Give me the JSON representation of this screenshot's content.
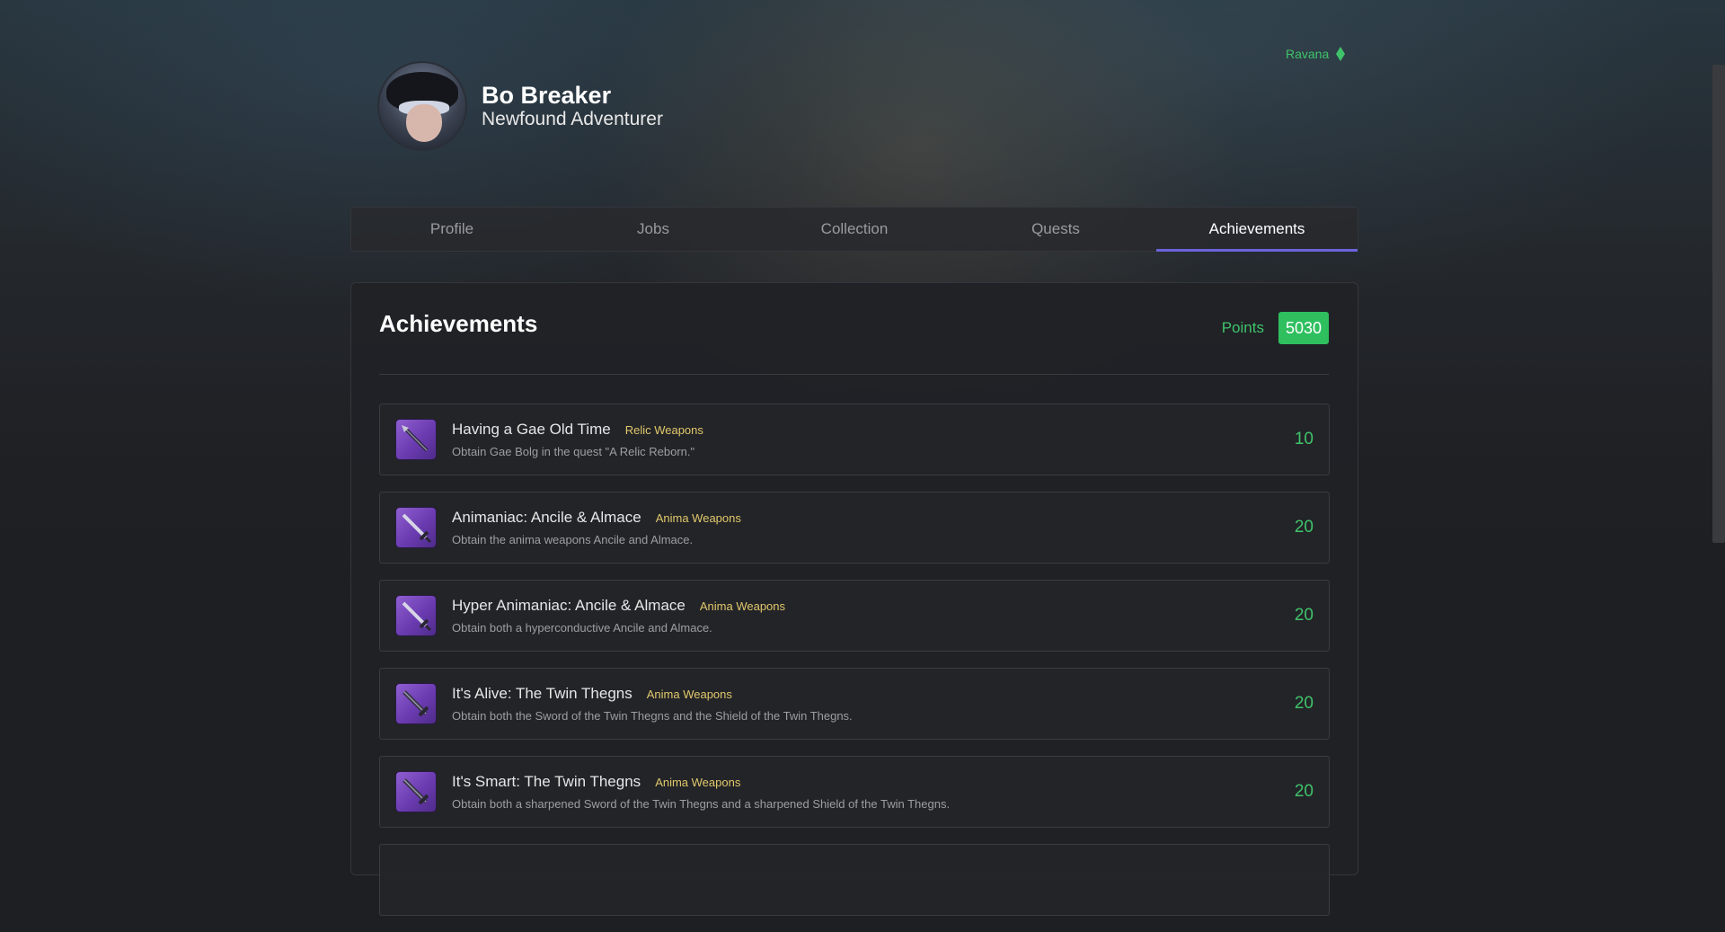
{
  "world": {
    "name": "Ravana",
    "icon": "diamond-icon",
    "color": "#3fc36a"
  },
  "character": {
    "name": "Bo Breaker",
    "title": "Newfound Adventurer"
  },
  "tabs": [
    {
      "label": "Profile",
      "active": false
    },
    {
      "label": "Jobs",
      "active": false
    },
    {
      "label": "Collection",
      "active": false
    },
    {
      "label": "Quests",
      "active": false
    },
    {
      "label": "Achievements",
      "active": true
    }
  ],
  "achievements": {
    "heading": "Achievements",
    "points_label": "Points",
    "points_value": "5030",
    "items": [
      {
        "name": "Having a Gae Old Time",
        "category": "Relic Weapons",
        "description": "Obtain Gae Bolg in the quest \"A Relic Reborn.\"",
        "points": "10",
        "icon": "spear-icon"
      },
      {
        "name": "Animaniac: Ancile & Almace",
        "category": "Anima Weapons",
        "description": "Obtain the anima weapons Ancile and Almace.",
        "points": "20",
        "icon": "sword-icon"
      },
      {
        "name": "Hyper Animaniac: Ancile & Almace",
        "category": "Anima Weapons",
        "description": "Obtain both a hyperconductive Ancile and Almace.",
        "points": "20",
        "icon": "sword-icon"
      },
      {
        "name": "It's Alive: The Twin Thegns",
        "category": "Anima Weapons",
        "description": "Obtain both the Sword of the Twin Thegns and the Shield of the Twin Thegns.",
        "points": "20",
        "icon": "sword-icon"
      },
      {
        "name": "It's Smart: The Twin Thegns",
        "category": "Anima Weapons",
        "description": "Obtain both a sharpened Sword of the Twin Thegns and a sharpened Shield of the Twin Thegns.",
        "points": "20",
        "icon": "sword-icon"
      }
    ]
  },
  "colors": {
    "accent": "#6c63dc",
    "points_green": "#2fbf5f",
    "category_gold": "#e1c86b"
  }
}
